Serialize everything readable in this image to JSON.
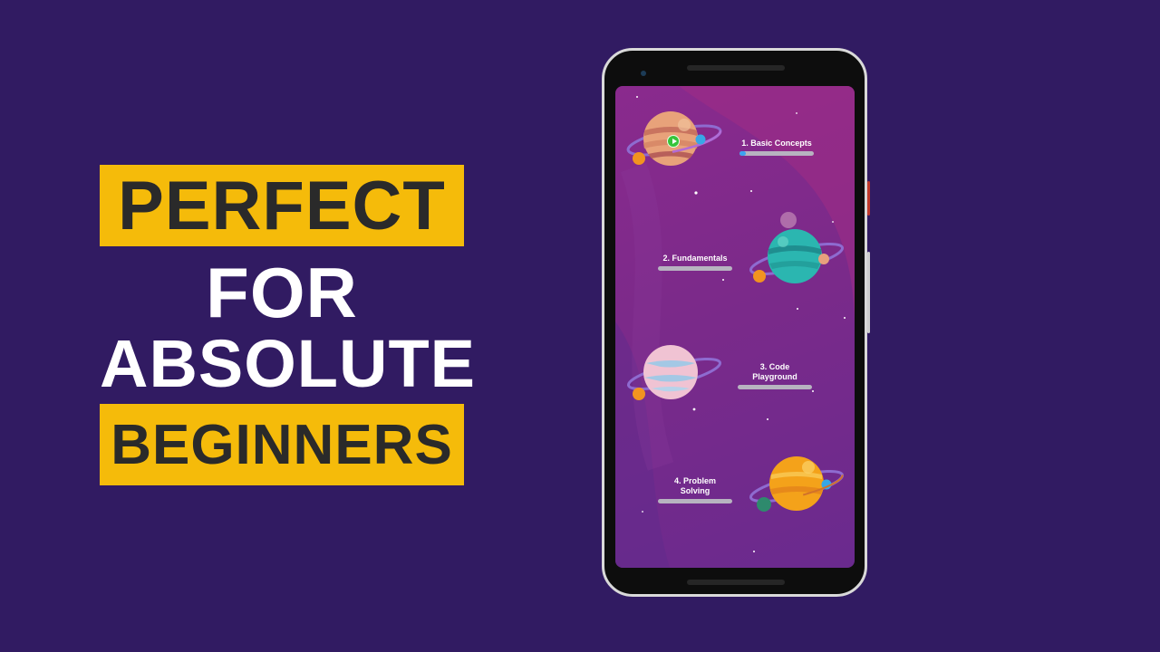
{
  "headline": {
    "line1": "PERFECT",
    "line2": "FOR",
    "line3": "ABSOLUTE",
    "line4": "BEGINNERS"
  },
  "colors": {
    "background": "#311b62",
    "banner": "#f5bb0a",
    "banner_text": "#2a2a2a",
    "progress_fill": "#3da1f0",
    "progress_track": "#b7b3c0"
  },
  "app": {
    "levels": [
      {
        "label": "1. Basic Concepts",
        "progress": 0.08,
        "planet": "orange-striped-planet",
        "current": true
      },
      {
        "label": "2. Fundamentals",
        "progress": 0,
        "planet": "teal-planet"
      },
      {
        "label": "3. Code Playground",
        "progress": 0,
        "planet": "pink-planet"
      },
      {
        "label": "4. Problem Solving",
        "progress": 0,
        "planet": "yellow-planet"
      }
    ]
  }
}
